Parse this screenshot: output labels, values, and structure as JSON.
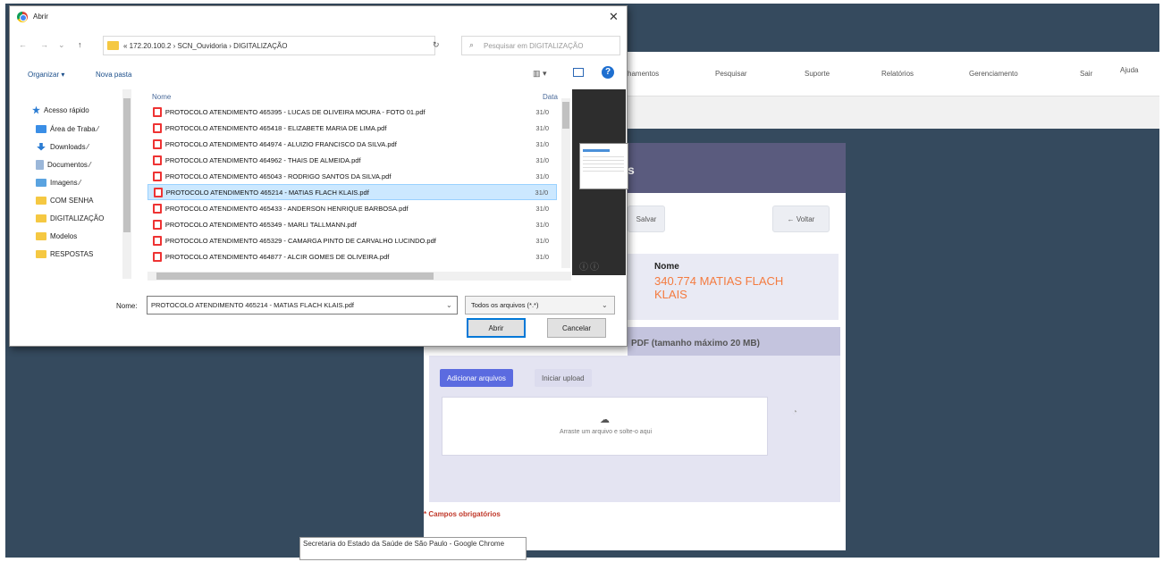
{
  "webapp": {
    "nav": [
      "hamentos",
      "Pesquisar",
      "Suporte",
      "Relatórios",
      "Gerenciamento",
      "Sair",
      "Ajuda"
    ],
    "card_title": "s",
    "save_label": "Salvar",
    "back_label": "← Voltar",
    "name_label": "Nome",
    "name_value": "340.774 MATIAS FLACH KLAIS",
    "upload_header": "PDF (tamanho máximo 20 MB)",
    "add_files": "Adicionar arquivos",
    "start_upload": "Iniciar upload",
    "drop_text": "Arraste um arquivo e solte-o aqui",
    "required_text": "* Campos obrigatórios",
    "tooltip": "Secretaria do Estado da Saúde de São Paulo - Google Chrome"
  },
  "dialog": {
    "title": "Abrir",
    "path": "« 172.20.100.2 › SCN_Ouvidoria › DIGITALIZAÇÃO",
    "search_placeholder": "Pesquisar em DIGITALIZAÇÃO",
    "organize": "Organizar ▾",
    "new_folder": "Nova pasta",
    "nav_items": [
      {
        "label": "Acesso rápido",
        "icon": "star-icon",
        "color": "#2b7cd3"
      },
      {
        "label": "Área de Traba ⁄",
        "icon": "desktop-icon",
        "color": "#3a8ee6"
      },
      {
        "label": "Downloads ⁄",
        "icon": "download-icon",
        "color": "#2b7cd3"
      },
      {
        "label": "Documentos ⁄",
        "icon": "document-icon",
        "color": "#9bb7d9"
      },
      {
        "label": "Imagens ⁄",
        "icon": "image-icon",
        "color": "#5aa3e0"
      },
      {
        "label": "COM SENHA",
        "icon": "folder-icon",
        "color": "#f5c842"
      },
      {
        "label": "DIGITALIZAÇÃO",
        "icon": "folder-icon",
        "color": "#f5c842"
      },
      {
        "label": "Modelos",
        "icon": "folder-icon",
        "color": "#f5c842"
      },
      {
        "label": "RESPOSTAS",
        "icon": "folder-icon",
        "color": "#f5c842"
      }
    ],
    "col_name": "Nome",
    "col_date": "Data",
    "files": [
      {
        "name": "PROTOCOLO ATENDIMENTO 465395 - LUCAS DE OLIVEIRA MOURA - FOTO 01.pdf",
        "date": "31/0"
      },
      {
        "name": "PROTOCOLO ATENDIMENTO 465418 - ELIZABETE MARIA DE LIMA.pdf",
        "date": "31/0"
      },
      {
        "name": "PROTOCOLO ATENDIMENTO 464974 - ALUIZIO FRANCISCO DA SILVA.pdf",
        "date": "31/0"
      },
      {
        "name": "PROTOCOLO ATENDIMENTO 464962 - THAIS DE ALMEIDA.pdf",
        "date": "31/0"
      },
      {
        "name": "PROTOCOLO ATENDIMENTO 465043 - RODRIGO SANTOS DA SILVA.pdf",
        "date": "31/0"
      },
      {
        "name": "PROTOCOLO ATENDIMENTO 465214 - MATIAS FLACH KLAIS.pdf",
        "date": "31/0",
        "selected": true
      },
      {
        "name": "PROTOCOLO ATENDIMENTO 465433 - ANDERSON HENRIQUE BARBOSA.pdf",
        "date": "31/0"
      },
      {
        "name": "PROTOCOLO ATENDIMENTO 465349 - MARLI TALLMANN.pdf",
        "date": "31/0"
      },
      {
        "name": "PROTOCOLO ATENDIMENTO 465329 - CAMARGA PINTO DE CARVALHO LUCINDO.pdf",
        "date": "31/0"
      },
      {
        "name": "PROTOCOLO ATENDIMENTO 464877 - ALCIR GOMES DE OLIVEIRA.pdf",
        "date": "31/0"
      }
    ],
    "filename_label": "Nome:",
    "filename_value": "PROTOCOLO ATENDIMENTO 465214 - MATIAS FLACH KLAIS.pdf",
    "filter_value": "Todos os arquivos (*.*)",
    "open_label": "Abrir",
    "cancel_label": "Cancelar"
  }
}
